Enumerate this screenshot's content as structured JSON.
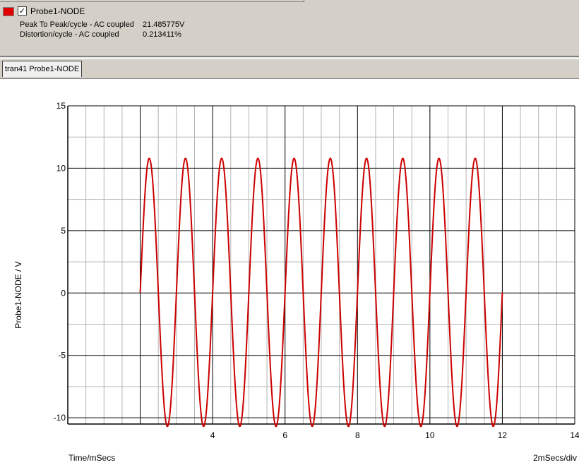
{
  "probe": {
    "color": "#e00000",
    "checked_glyph": "✓",
    "name": "Probe1-NODE",
    "measurements": [
      {
        "label": "Peak To Peak/cycle - AC coupled",
        "value": "21.485775V"
      },
      {
        "label": "Distortion/cycle - AC coupled",
        "value": "0.213411%"
      }
    ]
  },
  "tabs": [
    {
      "label": "tran41 Probe1-NODE",
      "active": true
    }
  ],
  "chart_data": {
    "type": "line",
    "ylabel": "Probe1-NODE / V",
    "xlabel": "Time/mSecs",
    "scale_label": "2mSecs/div",
    "xlim": [
      0,
      14
    ],
    "ylim": [
      -10.5,
      15
    ],
    "x_ticks": [
      4,
      6,
      8,
      10,
      12,
      14
    ],
    "y_ticks": [
      15,
      10,
      5,
      0,
      -5,
      -10
    ],
    "grid": true,
    "series": [
      {
        "color": "#cc0000",
        "waveform": "sine",
        "amplitude": 10.74,
        "offset": 0.05,
        "period": 1.0,
        "x_start": 2.0,
        "x_end": 12.0
      }
    ]
  }
}
